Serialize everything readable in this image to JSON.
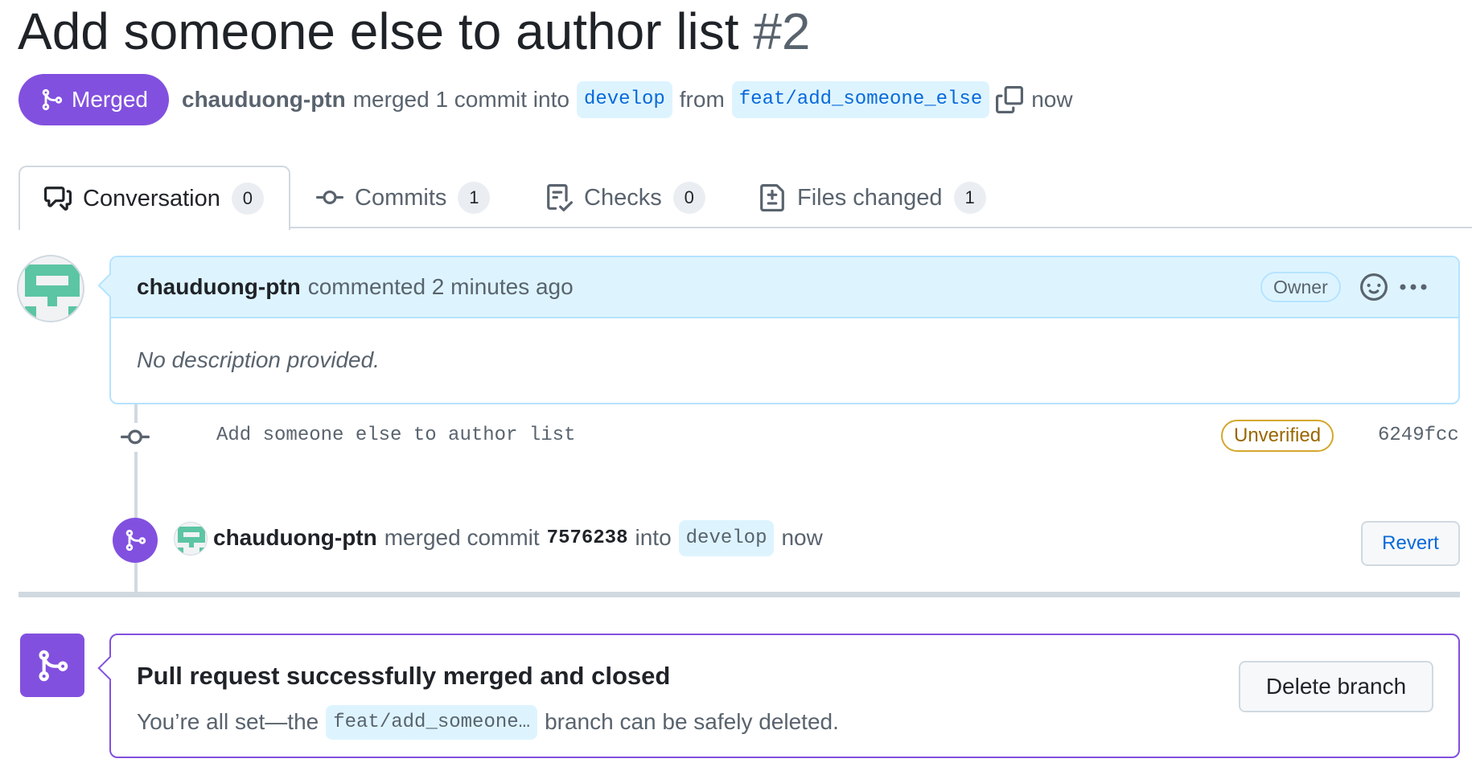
{
  "pr": {
    "title": "Add someone else to author list",
    "number": "#2"
  },
  "state_badge": {
    "label": "Merged",
    "icon": "git-merge-icon",
    "color": "#8250df"
  },
  "meta": {
    "author": "chauduong-ptn",
    "action": "merged 1 commit into",
    "base_branch": "develop",
    "from_word": "from",
    "head_branch": "feat/add_someone_else",
    "copy_icon": "copy-icon",
    "time": "now"
  },
  "tabs": [
    {
      "label": "Conversation",
      "count": "0",
      "icon": "comment-discussion-icon",
      "active": true
    },
    {
      "label": "Commits",
      "count": "1",
      "icon": "git-commit-icon",
      "active": false
    },
    {
      "label": "Checks",
      "count": "0",
      "icon": "checklist-icon",
      "active": false
    },
    {
      "label": "Files changed",
      "count": "1",
      "icon": "file-diff-icon",
      "active": false
    }
  ],
  "comment": {
    "author": "chauduong-ptn",
    "action": "commented 2 minutes ago",
    "role_badge": "Owner",
    "body": "No description provided.",
    "header_color": "#ddf4ff"
  },
  "commit": {
    "message": "Add someone else to author list",
    "verification": "Unverified",
    "sha": "6249fcc"
  },
  "merge_event": {
    "author": "chauduong-ptn",
    "action": "merged commit",
    "sha": "7576238",
    "into_word": "into",
    "branch": "develop",
    "time": "now",
    "revert_label": "Revert"
  },
  "merge_box": {
    "title": "Pull request successfully merged and closed",
    "desc_before": "You’re all set—the",
    "branch": "feat/add_someone…",
    "desc_after": "branch can be safely deleted.",
    "delete_label": "Delete branch"
  }
}
